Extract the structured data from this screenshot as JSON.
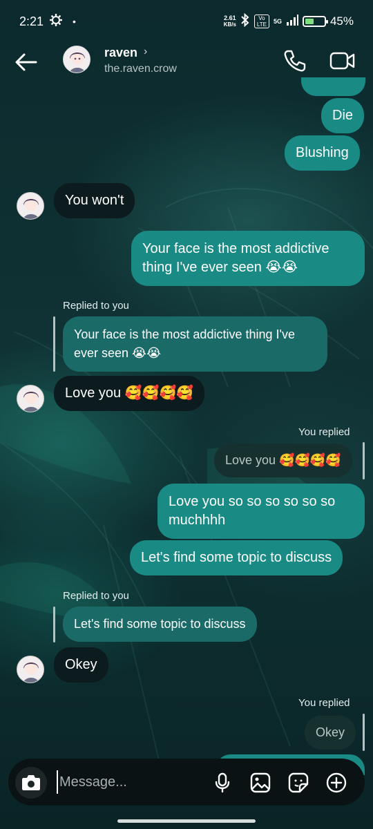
{
  "status_bar": {
    "time": "2:21",
    "net_speed_value": "2.61",
    "net_speed_unit": "KB/s",
    "volte": "Vo LTE",
    "network": "5G",
    "battery_percent": "45%",
    "battery_level": 0.45
  },
  "header": {
    "name": "raven",
    "username": "the.raven.crow"
  },
  "messages": {
    "m_die": "Die",
    "m_blushing": "Blushing",
    "m_you_wont": "You won't",
    "m_face": "Your face is the most addictive thing I've ever seen 😭😭",
    "replied_to_you_1": "Replied to you",
    "quote_face": "Your face is the most addictive thing I've ever seen 😭😭",
    "m_love_you": "Love you 🥰🥰🥰🥰",
    "you_replied_1": "You replied",
    "quote_love_you": "Love you 🥰🥰🥰🥰",
    "m_love_so_much": "Love you so so so so so so muchhhh",
    "m_topic": "Let's find some topic to discuss",
    "replied_to_you_2": "Replied to you",
    "quote_topic": "Let's find some topic to discuss",
    "m_okey": "Okey",
    "you_replied_2": "You replied",
    "quote_okey": "Okey"
  },
  "composer": {
    "placeholder": "Message..."
  },
  "colors": {
    "outgoing_bubble": "#1a8a84",
    "incoming_bubble": "#0c1b1d",
    "composer_bg": "#0a1213"
  }
}
